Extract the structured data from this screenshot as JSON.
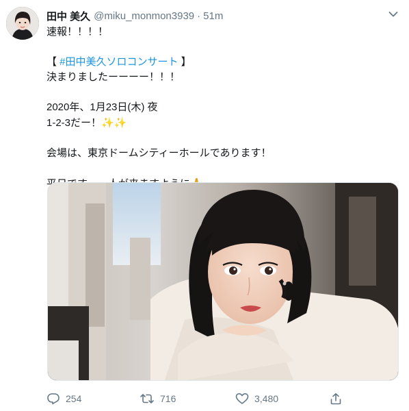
{
  "author": {
    "name": "田中 美久",
    "handle": "@miku_monmon3939",
    "separator": "·",
    "time": "51m"
  },
  "tweet": {
    "line1": "速報！！！！",
    "hashtag_open": "【 ",
    "hashtag": "#田中美久ソロコンサート",
    "hashtag_close": " 】",
    "line2": "決まりましたーーーー！！！",
    "line3": "2020年、1月23日(木)  夜",
    "line4": "1-2-3だー！",
    "sparkles": "✨✨",
    "line5": "会場は、東京ドームシティーホールであります！",
    "line6": "平日です…。人が来ますように",
    "pray": "🙏"
  },
  "actions": {
    "replies": "254",
    "retweets": "716",
    "likes": "3,480"
  },
  "icons": {
    "reply": "reply-icon",
    "retweet": "retweet-icon",
    "like": "heart-icon",
    "share": "share-icon",
    "menu": "chevron-down-icon"
  },
  "colors": {
    "link": "#1b95e0",
    "secondary_text": "#657786",
    "text": "#14171a"
  }
}
